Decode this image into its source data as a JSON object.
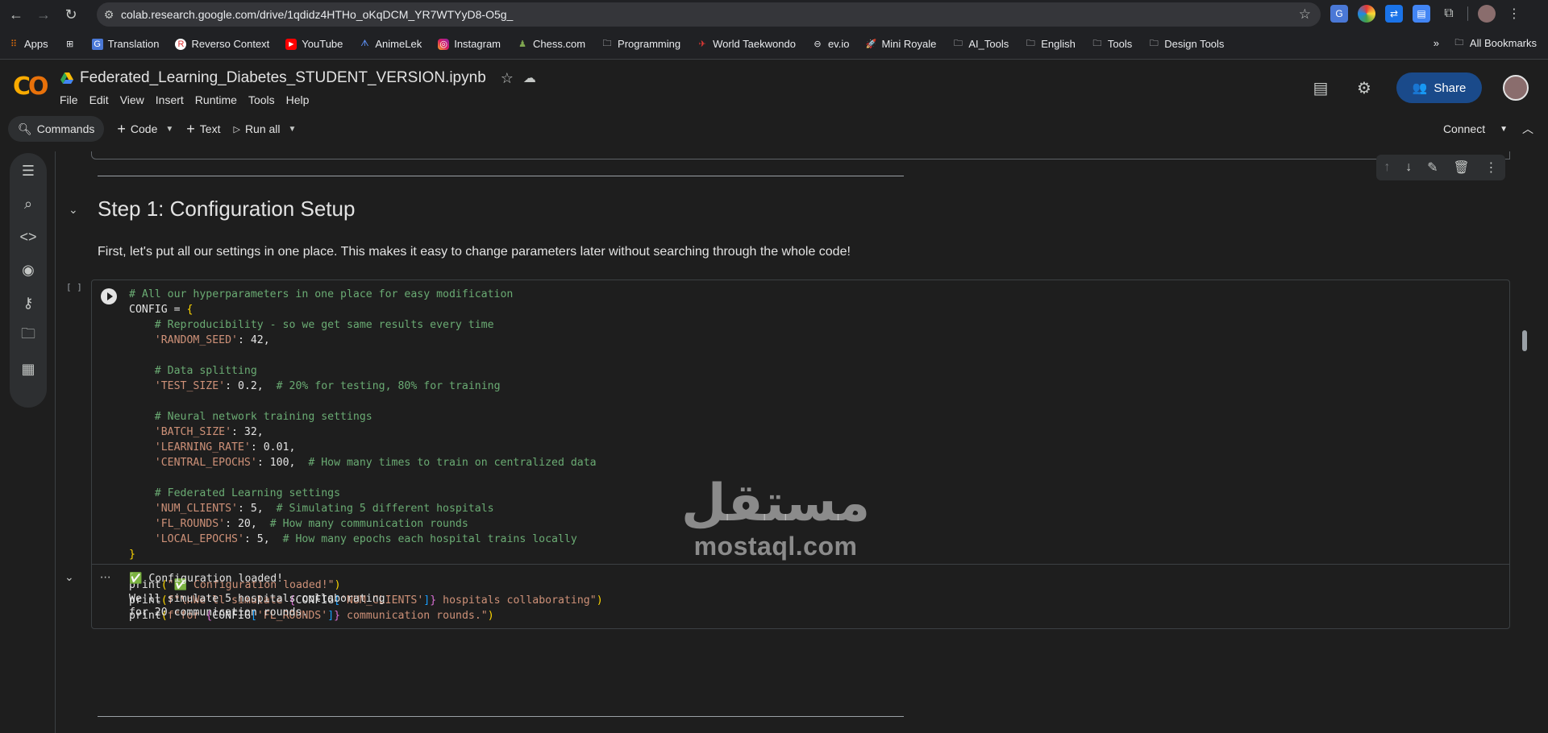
{
  "browser": {
    "url": "colab.research.google.com/drive/1qdidz4HTHo_oKqDCM_YR7WTYyD8-O5g_",
    "bookmarks": [
      {
        "label": "Apps",
        "icon": "apps-grid-icon"
      },
      {
        "label": "",
        "icon": "grid-icon"
      },
      {
        "label": "Translation",
        "icon": "translate-icon"
      },
      {
        "label": "Reverso Context",
        "icon": "reverso-icon"
      },
      {
        "label": "YouTube",
        "icon": "youtube-icon"
      },
      {
        "label": "AnimeLek",
        "icon": "animelek-icon"
      },
      {
        "label": "Instagram",
        "icon": "instagram-icon"
      },
      {
        "label": "Chess.com",
        "icon": "chess-icon"
      },
      {
        "label": "Programming",
        "icon": "folder-icon"
      },
      {
        "label": "World Taekwondo",
        "icon": "taekwondo-icon"
      },
      {
        "label": "ev.io",
        "icon": "evio-icon"
      },
      {
        "label": "Mini Royale",
        "icon": "mini-royale-icon"
      },
      {
        "label": "AI_Tools",
        "icon": "folder-icon"
      },
      {
        "label": "English",
        "icon": "folder-icon"
      },
      {
        "label": "Tools",
        "icon": "folder-icon"
      },
      {
        "label": "Design Tools",
        "icon": "folder-icon"
      }
    ],
    "all_bookmarks": "All Bookmarks"
  },
  "colab": {
    "title": "Federated_Learning_Diabetes_STUDENT_VERSION.ipynb",
    "menu": [
      "File",
      "Edit",
      "View",
      "Insert",
      "Runtime",
      "Tools",
      "Help"
    ],
    "share_label": "Share",
    "toolbar": {
      "commands": "Commands",
      "code": "Code",
      "text": "Text",
      "run_all": "Run all",
      "connect": "Connect"
    }
  },
  "notebook": {
    "heading": "Step 1: Configuration Setup",
    "paragraph": "First, let's put all our settings in one place. This makes it easy to change parameters later without searching through the whole code!",
    "exec_count": "[ ]",
    "output_lines": [
      "✅ Configuration loaded!",
      "",
      "We'll simulate 5 hospitals collaborating",
      "for 20 communication rounds."
    ]
  },
  "watermark": {
    "arabic": "مستقل",
    "latin": "mostaql.com"
  },
  "colors": {
    "comment": "#6aab73",
    "string": "#ce9178",
    "brace": "#ffd700",
    "share_button": "#1a4a8a"
  }
}
